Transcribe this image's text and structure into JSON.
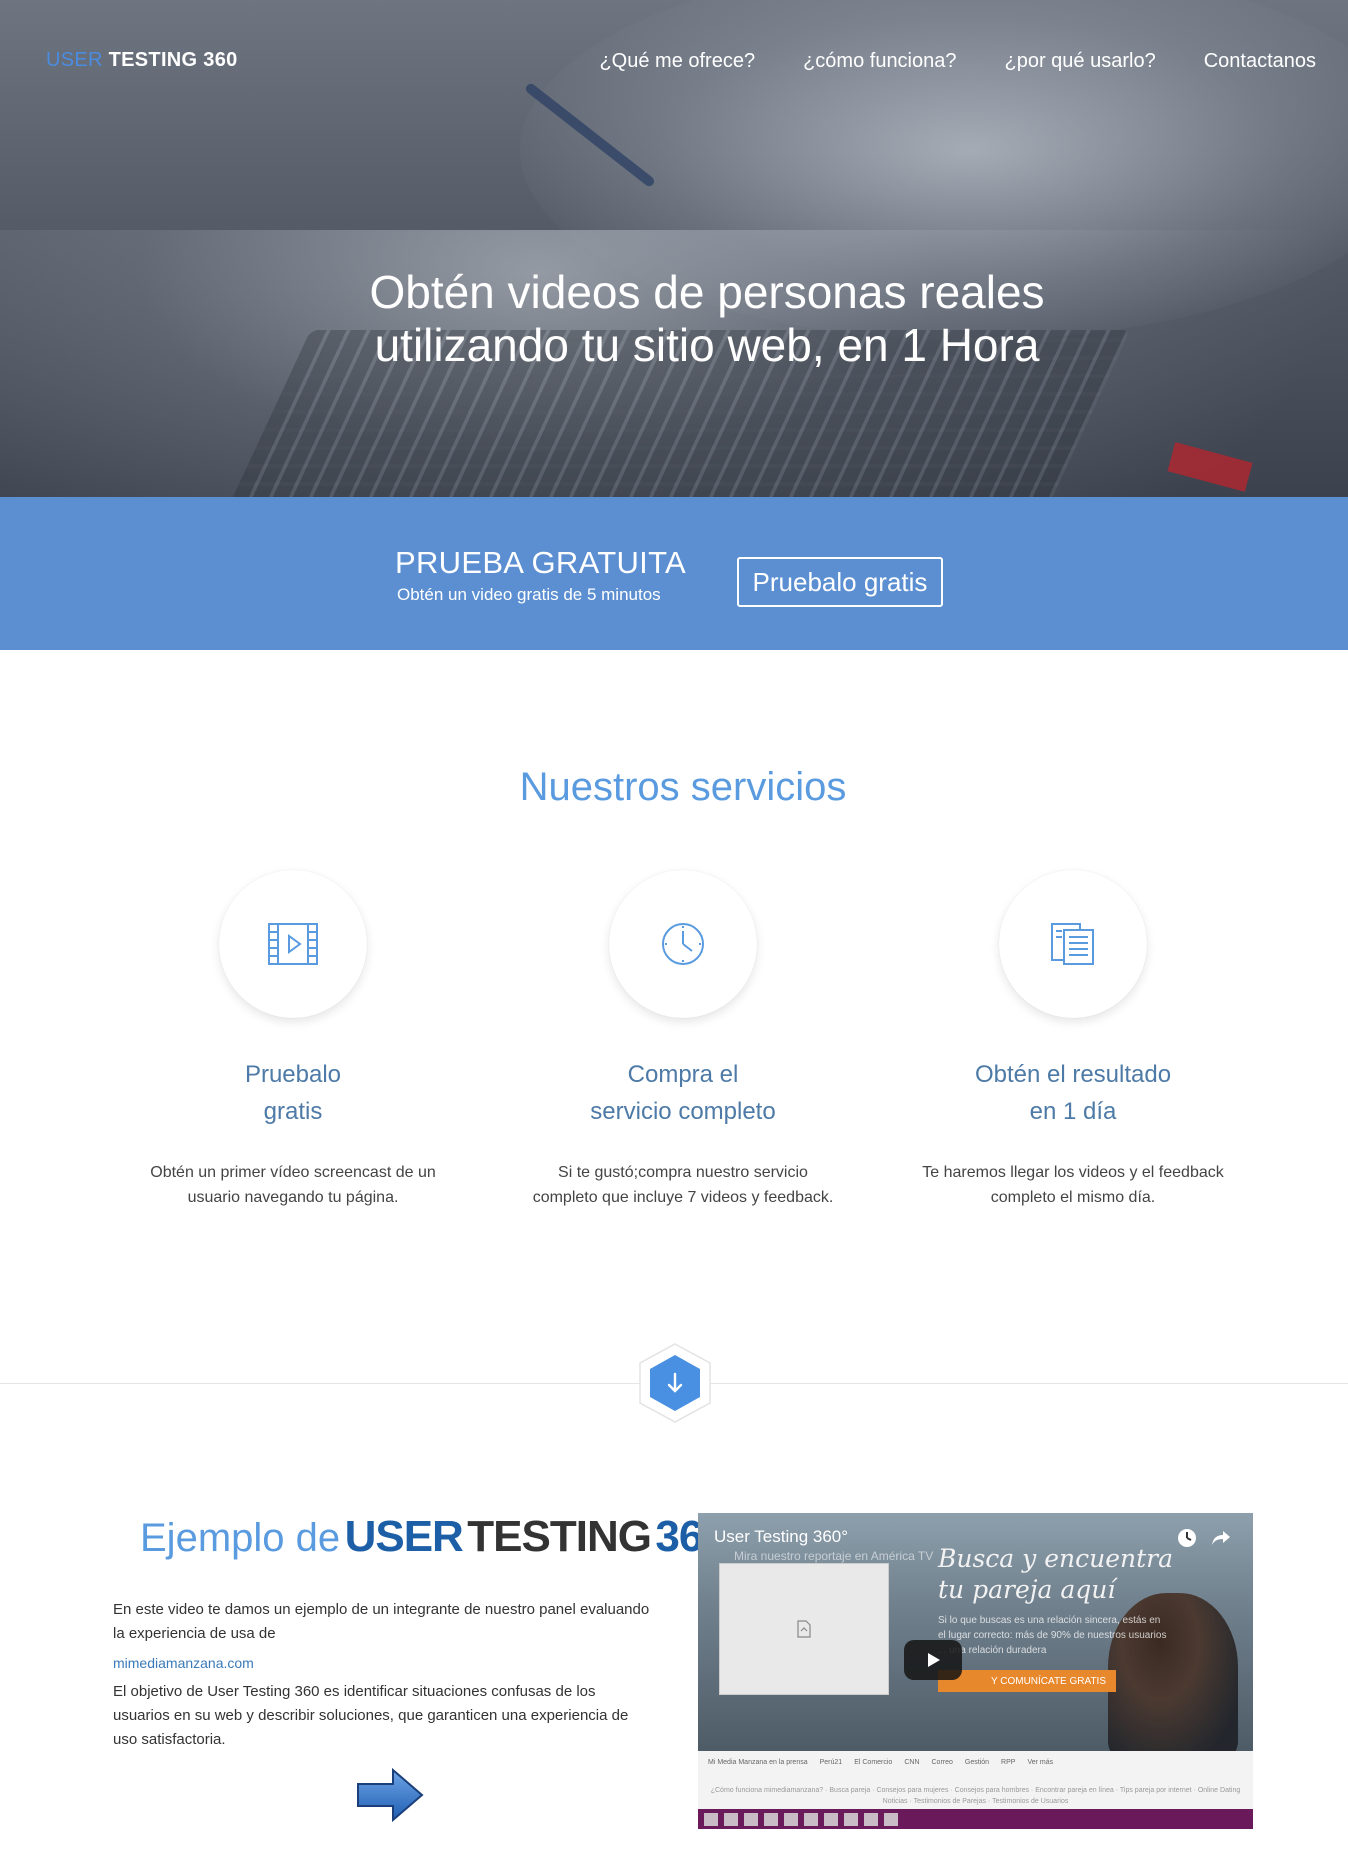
{
  "header": {
    "logo_part1": "USER",
    "logo_part2": "TESTING 360",
    "nav": [
      {
        "label": "¿Qué me ofrece?"
      },
      {
        "label": "¿cómo funciona?"
      },
      {
        "label": "¿por qué usarlo?"
      },
      {
        "label": "Contactanos"
      }
    ]
  },
  "hero": {
    "title_line1": "Obtén videos de personas reales",
    "title_line2": "utilizando tu sitio web, en 1 Hora"
  },
  "trial": {
    "title": "PRUEBA GRATUITA",
    "subtitle": "Obtén un video gratis de 5 minutos",
    "button": "Pruebalo gratis"
  },
  "services": {
    "title": "Nuestros servicios",
    "items": [
      {
        "icon": "video-icon",
        "title_line1": "Pruebalo",
        "title_line2": "gratis",
        "desc_line1": "Obtén un primer vídeo screencast de un",
        "desc_line2": "usuario navegando tu página."
      },
      {
        "icon": "clock-icon",
        "title_line1": "Compra el",
        "title_line2": "servicio completo",
        "desc_line1": "Si te gustó;compra nuestro servicio",
        "desc_line2": "completo que incluye 7 videos y feedback."
      },
      {
        "icon": "document-icon",
        "title_line1": "Obtén el resultado",
        "title_line2": "en 1 día",
        "desc_line1": "Te haremos llegar los videos y el feedback",
        "desc_line2": "completo el mismo día."
      }
    ]
  },
  "example": {
    "title_prefix": "Ejemplo de",
    "title_user": "USER",
    "title_testing": "TESTING",
    "title_360": "360",
    "para1_line1": "En este video te damos un ejemplo de un integrante de nuestro panel evaluando",
    "para1_line2": "la experiencia de usa de",
    "link": "mimediamanzana.com",
    "para2_line1": "El objetivo de User Testing 360 es identificar situaciones confusas de los",
    "para2_line2": "usuarios en su web y describir soluciones, que garanticen una experiencia de",
    "para2_line3": "uso satisfactoria."
  },
  "video": {
    "title": "User Testing 360°",
    "subtitle": "Mira nuestro reportaje en América TV",
    "headline_line1": "Busca y encuentra",
    "headline_line2": "tu pareja aquí",
    "body": "Si lo que buscas es una relación sincera, estás en el lugar correcto: más de 90% de nuestros usuarios ... una relación duradera",
    "cta": "Y COMUNÍCATE GRATIS",
    "strip_logos": [
      "Mi Media Manzana en la prensa",
      "Perú21",
      "El Comercio",
      "CNN",
      "Correo",
      "Gestión",
      "RPP",
      "Ver más"
    ],
    "strip_text": "¿Cómo funciona mimediamanzana? · Busca pareja · Consejos para mujeres · Consejos para hombres · Encontrar pareja en línea · Tips pareja por internet · Online Dating Noticias · Testimonios de Parejas · Testimonios de Usuarios"
  },
  "colors": {
    "accent": "#4f87ce",
    "brand_blue": "#1d5fa6",
    "service_title": "#4d7aa6",
    "section_title": "#5a9be0"
  }
}
